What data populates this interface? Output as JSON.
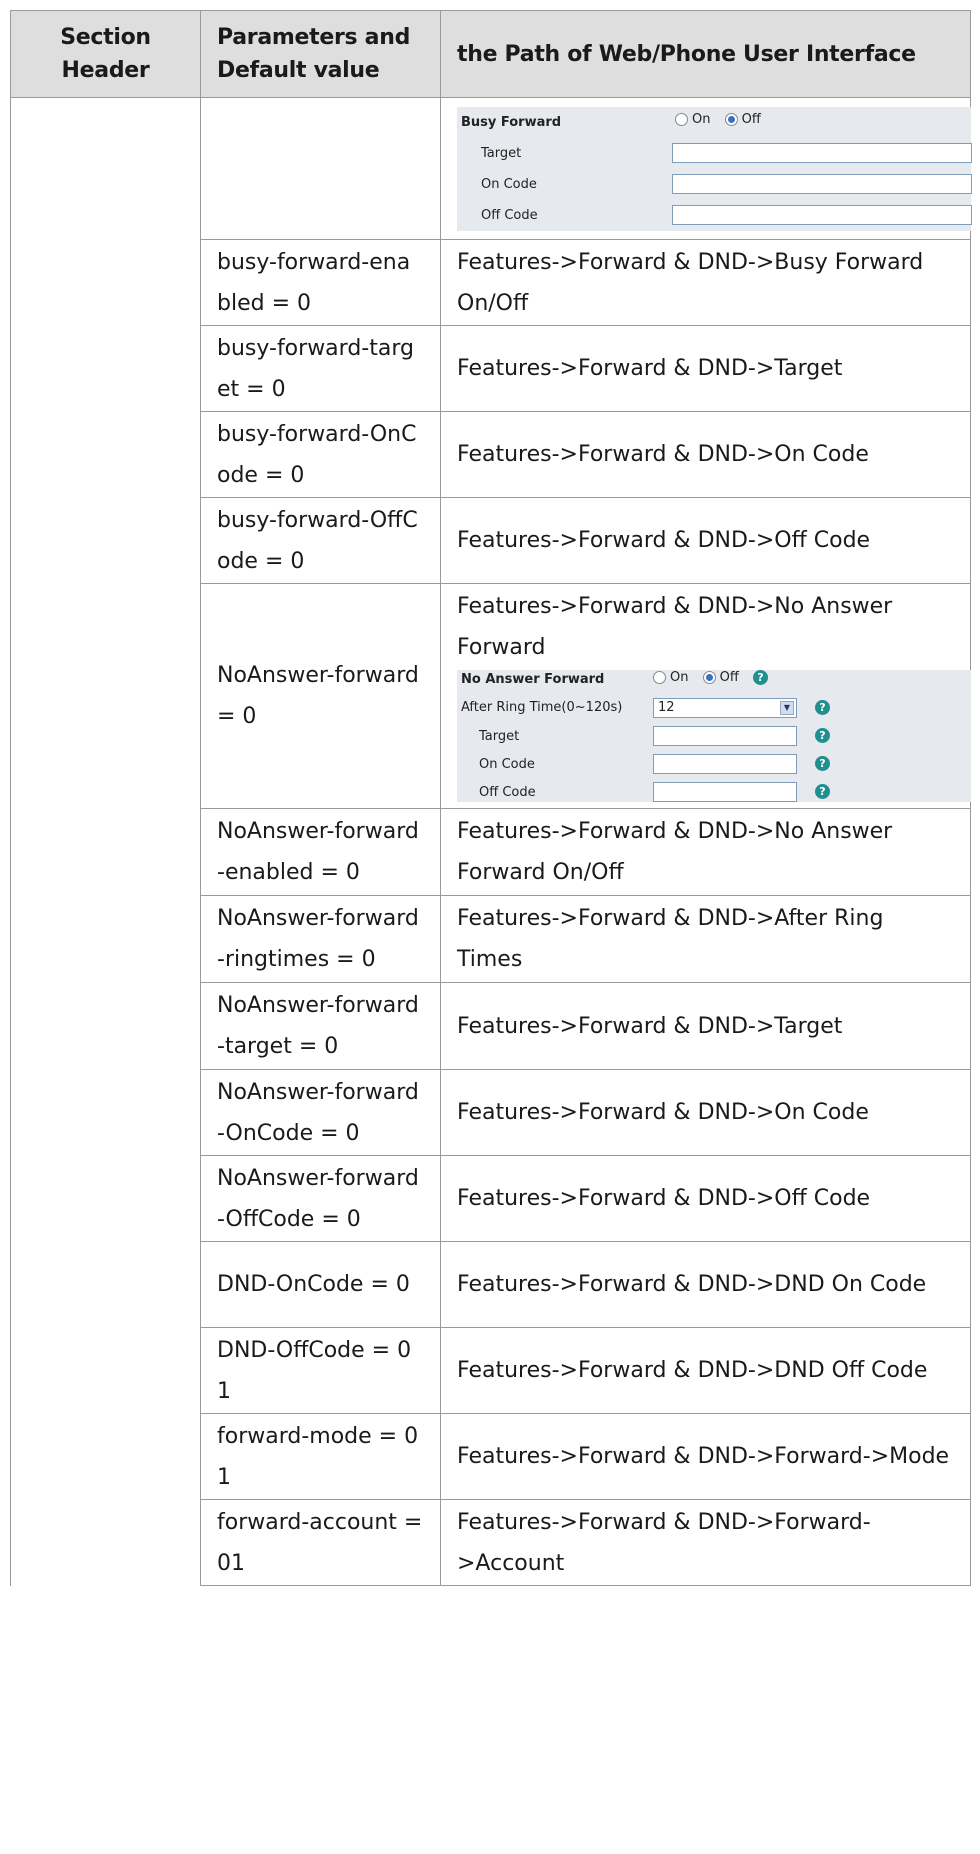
{
  "table": {
    "headers": [
      "Section Header",
      "Parameters and Default value",
      "the Path of Web/Phone User Interface"
    ],
    "busy_panel": {
      "title": "Busy Forward",
      "on_label": "On",
      "off_label": "Off",
      "selected": "Off",
      "rows": [
        "Target",
        "On Code",
        "Off Code"
      ]
    },
    "rows": [
      {
        "param": "busy-forward-enabled = 0",
        "path": "Features->Forward & DND->Busy Forward On/Off"
      },
      {
        "param": "busy-forward-target = 0",
        "path": "Features->Forward & DND->Target"
      },
      {
        "param": "busy-forward-OnCode = 0",
        "path": "Features->Forward & DND->On Code"
      },
      {
        "param": "busy-forward-OffCode = 0",
        "path": "Features->Forward & DND->Off Code"
      },
      {
        "param": "NoAnswer-forward = 0",
        "path": "Features->Forward & DND->No Answer Forward"
      },
      {
        "param": "NoAnswer-forward-enabled = 0",
        "path": "Features->Forward & DND->No Answer Forward On/Off"
      },
      {
        "param": "NoAnswer-forward-ringtimes = 0",
        "path": "Features->Forward & DND->After Ring Times"
      },
      {
        "param": "NoAnswer-forward-target = 0",
        "path": "Features->Forward & DND->Target"
      },
      {
        "param": "NoAnswer-forward-OnCode = 0",
        "path": "Features->Forward & DND->On Code"
      },
      {
        "param": "NoAnswer-forward-OffCode = 0",
        "path": "Features->Forward & DND->Off Code"
      },
      {
        "param": "DND-OnCode = 0",
        "path": "Features->Forward & DND->DND On Code"
      },
      {
        "param": "DND-OffCode = 01",
        "path": "Features->Forward & DND->DND Off Code"
      },
      {
        "param": "forward-mode = 01",
        "path": "Features->Forward & DND->Forward->Mode"
      },
      {
        "param": "forward-account = 01",
        "path": "Features->Forward & DND->Forward->Account"
      }
    ],
    "noanswer_panel": {
      "title": "No Answer Forward",
      "on_label": "On",
      "off_label": "Off",
      "selected": "Off",
      "ring_label": "After Ring Time(0~120s)",
      "ring_value": "12",
      "rows": [
        "Target",
        "On Code",
        "Off Code"
      ],
      "help_glyph": "?"
    }
  }
}
